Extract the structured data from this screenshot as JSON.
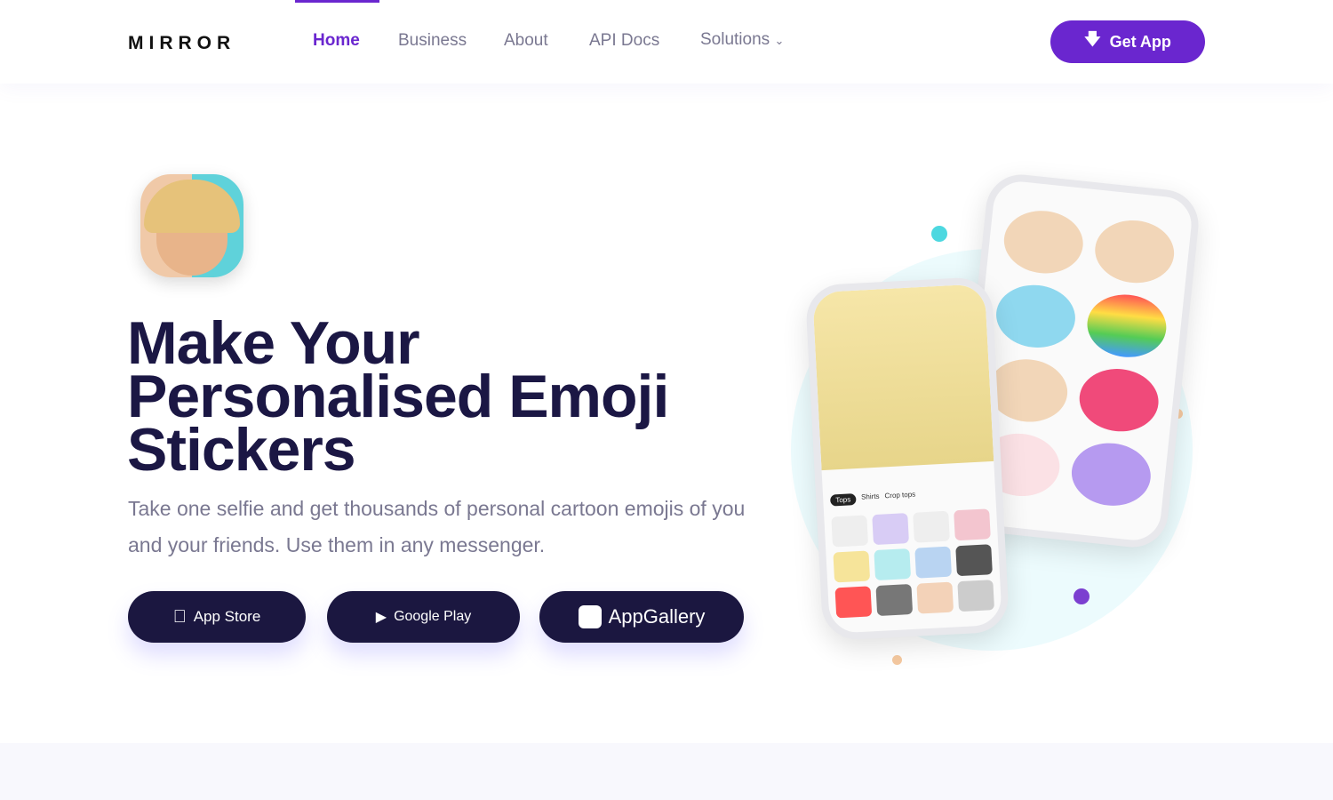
{
  "nav": {
    "logo": "MIRROR",
    "links": [
      {
        "label": "Home",
        "active": true
      },
      {
        "label": "Business"
      },
      {
        "label": "About"
      },
      {
        "label": "API Docs"
      },
      {
        "label": "Solutions"
      }
    ],
    "cta": "Get App"
  },
  "hero": {
    "title": "Make Your Personalised Emoji Stickers",
    "subtitle": "Take one selfie and get thousands of personal cartoon emojis of you and your friends. Use them in any messenger.",
    "stores": [
      {
        "label": "App Store",
        "icon": "apple-icon"
      },
      {
        "label": "Google Play",
        "icon": "google-play-icon"
      },
      {
        "label": "AppGallery",
        "icon": "huawei-icon"
      }
    ]
  },
  "phone": {
    "tabs": [
      "Tops",
      "Shirts",
      "Crop tops"
    ]
  },
  "colors": {
    "accent": "#6a26cf",
    "dark": "#1b1740",
    "text_muted": "#7a7891"
  }
}
